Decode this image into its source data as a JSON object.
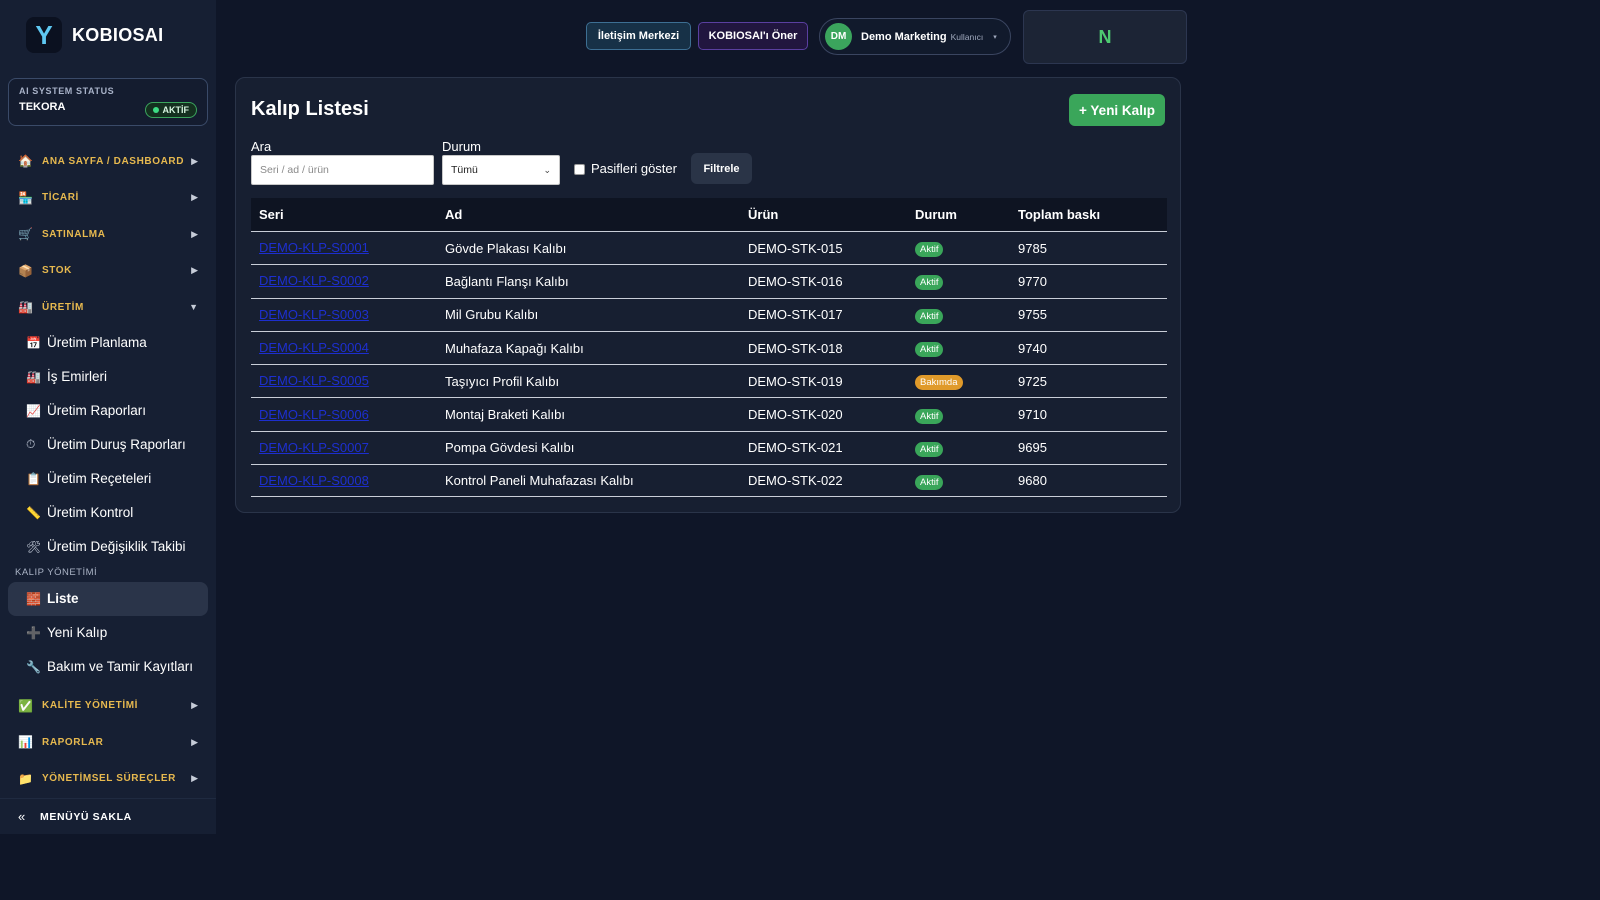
{
  "brand": {
    "logo_letter": "Y",
    "name": "KOBIOSAI"
  },
  "system_status": {
    "title": "AI SYSTEM STATUS",
    "name": "TEKORA",
    "badge": "AKTİF"
  },
  "sidebar": {
    "groups_top": [
      {
        "icon": "🏠",
        "label": "ANA SAYFA / DASHBOARD",
        "chevron": "▶"
      },
      {
        "icon": "🏪",
        "label": "TİCARİ",
        "chevron": "▶"
      },
      {
        "icon": "🛒",
        "label": "SATINALMA",
        "chevron": "▶"
      },
      {
        "icon": "📦",
        "label": "STOK",
        "chevron": "▶"
      },
      {
        "icon": "🏭",
        "label": "ÜRETİM",
        "chevron": "▼"
      }
    ],
    "production_items": [
      {
        "icon": "📅",
        "label": "Üretim Planlama"
      },
      {
        "icon": "🏭",
        "label": "İş Emirleri"
      },
      {
        "icon": "📈",
        "label": "Üretim Raporları"
      },
      {
        "icon": "⏱",
        "label": "Üretim Duruş Raporları"
      },
      {
        "icon": "📋",
        "label": "Üretim Reçeteleri"
      },
      {
        "icon": "📏",
        "label": "Üretim Kontrol"
      },
      {
        "icon": "🛠",
        "label": "Üretim Değişiklik Takibi"
      }
    ],
    "mold_section_label": "KALIP YÖNETİMİ",
    "mold_items": [
      {
        "icon": "🧱",
        "label": "Liste"
      },
      {
        "icon": "➕",
        "label": "Yeni Kalıp"
      },
      {
        "icon": "🔧",
        "label": "Bakım ve Tamir Kayıtları"
      }
    ],
    "groups_bottom": [
      {
        "icon": "✅",
        "label": "KALİTE YÖNETİMİ",
        "chevron": "▶"
      },
      {
        "icon": "📊",
        "label": "RAPORLAR",
        "chevron": "▶"
      },
      {
        "icon": "📁",
        "label": "YÖNETİMSEL SÜREÇLER",
        "chevron": "▶"
      }
    ],
    "hide_menu": {
      "icon": "«",
      "label": "MENÜYÜ SAKLA"
    }
  },
  "topbar": {
    "contact_label": "İletişim Merkezi",
    "suggest_label": "KOBIOSAI'ı Öner",
    "user": {
      "initials": "DM",
      "name": "Demo Marketing",
      "role": "Kullanıcı",
      "caret": "▾"
    },
    "n_label": "N"
  },
  "page": {
    "title": "Kalıp Listesi",
    "new_button": "+ Yeni Kalıp",
    "search_label": "Ara",
    "search_placeholder": "Seri / ad / ürün",
    "search_value": "",
    "status_label": "Durum",
    "status_value": "Tümü",
    "show_passive_label": "Pasifleri göster",
    "filter_button": "Filtrele"
  },
  "table": {
    "headers": [
      "Seri",
      "Ad",
      "Ürün",
      "Durum",
      "Toplam baskı"
    ],
    "rows": [
      {
        "serial": "DEMO-KLP-S0001",
        "name": "Gövde Plakası Kalıbı",
        "product": "DEMO-STK-015",
        "status": "Aktif",
        "status_color": "#3aa65a",
        "total": "9785"
      },
      {
        "serial": "DEMO-KLP-S0002",
        "name": "Bağlantı Flanşı Kalıbı",
        "product": "DEMO-STK-016",
        "status": "Aktif",
        "status_color": "#3aa65a",
        "total": "9770"
      },
      {
        "serial": "DEMO-KLP-S0003",
        "name": "Mil Grubu Kalıbı",
        "product": "DEMO-STK-017",
        "status": "Aktif",
        "status_color": "#3aa65a",
        "total": "9755"
      },
      {
        "serial": "DEMO-KLP-S0004",
        "name": "Muhafaza Kapağı Kalıbı",
        "product": "DEMO-STK-018",
        "status": "Aktif",
        "status_color": "#3aa65a",
        "total": "9740"
      },
      {
        "serial": "DEMO-KLP-S0005",
        "name": "Taşıyıcı Profil Kalıbı",
        "product": "DEMO-STK-019",
        "status": "Bakımda",
        "status_color": "#e09a2a",
        "total": "9725"
      },
      {
        "serial": "DEMO-KLP-S0006",
        "name": "Montaj Braketi Kalıbı",
        "product": "DEMO-STK-020",
        "status": "Aktif",
        "status_color": "#3aa65a",
        "total": "9710"
      },
      {
        "serial": "DEMO-KLP-S0007",
        "name": "Pompa Gövdesi Kalıbı",
        "product": "DEMO-STK-021",
        "status": "Aktif",
        "status_color": "#3aa65a",
        "total": "9695"
      },
      {
        "serial": "DEMO-KLP-S0008",
        "name": "Kontrol Paneli Muhafazası Kalıbı",
        "product": "DEMO-STK-022",
        "status": "Aktif",
        "status_color": "#3aa65a",
        "total": "9680"
      }
    ]
  }
}
